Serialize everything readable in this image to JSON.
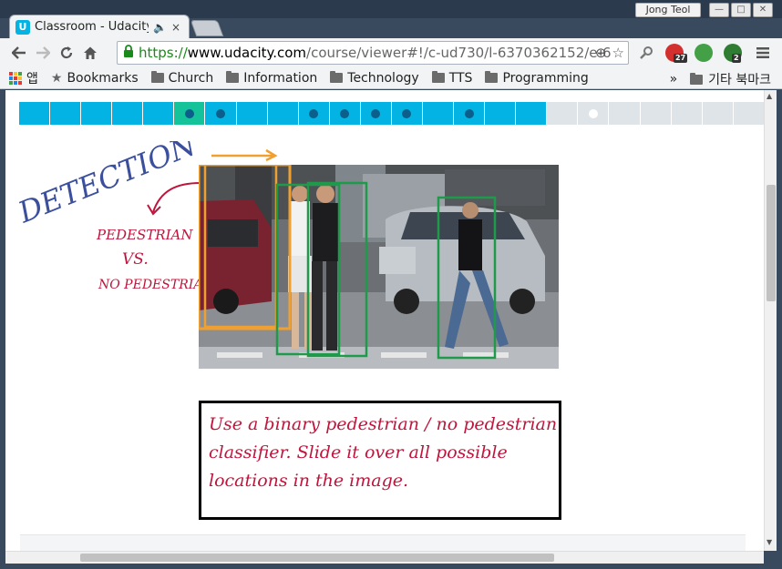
{
  "window": {
    "user_name": "Jong Teol",
    "minimize": "—",
    "maximize": "□",
    "close": "✕"
  },
  "tab": {
    "title": "Classroom - Udacity",
    "audio_icon": "speaker-icon",
    "close_label": "×"
  },
  "toolbar": {
    "url_scheme": "https://",
    "url_host": "www.udacity.com",
    "url_path": "/course/viewer#!/c-ud730/l-6370362152/e-6",
    "extensions": [
      {
        "name": "extension-red",
        "color": "#d32f2f",
        "badge": "27"
      },
      {
        "name": "extension-green-balloon",
        "color": "#43a047",
        "badge": ""
      },
      {
        "name": "extension-green-d",
        "color": "#2e7d32",
        "badge": "2"
      }
    ]
  },
  "bookmarks": {
    "apps_label": "앱",
    "items": [
      "Bookmarks",
      "Church",
      "Information",
      "Technology",
      "TTS",
      "Programming"
    ],
    "overflow": "»",
    "other_label": "기타 북마크"
  },
  "progress": {
    "segments": [
      {
        "state": "done",
        "dot": false
      },
      {
        "state": "done",
        "dot": false
      },
      {
        "state": "done",
        "dot": false
      },
      {
        "state": "done",
        "dot": false
      },
      {
        "state": "done",
        "dot": false
      },
      {
        "state": "current",
        "dot": true
      },
      {
        "state": "done",
        "dot": true
      },
      {
        "state": "done",
        "dot": false
      },
      {
        "state": "done",
        "dot": false
      },
      {
        "state": "done",
        "dot": true
      },
      {
        "state": "done",
        "dot": true
      },
      {
        "state": "done",
        "dot": true
      },
      {
        "state": "done",
        "dot": true
      },
      {
        "state": "done",
        "dot": false
      },
      {
        "state": "done",
        "dot": true
      },
      {
        "state": "done",
        "dot": false
      },
      {
        "state": "done",
        "dot": false
      },
      {
        "state": "todo",
        "dot": false
      },
      {
        "state": "todo",
        "dot": true
      },
      {
        "state": "todo",
        "dot": false
      },
      {
        "state": "todo",
        "dot": false
      },
      {
        "state": "todo",
        "dot": false
      },
      {
        "state": "todo",
        "dot": false
      },
      {
        "state": "todo",
        "dot": false
      }
    ],
    "colors": {
      "done": "#02b3e4",
      "current": "#15c39a",
      "todo": "#dfe4e8",
      "dot_done": "#0b5f8a",
      "dot_todo": "#ffffff"
    }
  },
  "slide": {
    "heading": "DETECTION",
    "label_1": "PEDESTRIAN",
    "label_2": "VS.",
    "label_3": "NO PEDESTRIAN",
    "note_lines": [
      "Use a binary pedestrian / no pedestrian",
      "classifier. Slide it over all possible",
      "locations in the image."
    ],
    "colors": {
      "heading": "#3b4f9c",
      "labels": "#c0143c",
      "orange_box": "#f0a030",
      "green_box": "#1f9a4a"
    }
  }
}
